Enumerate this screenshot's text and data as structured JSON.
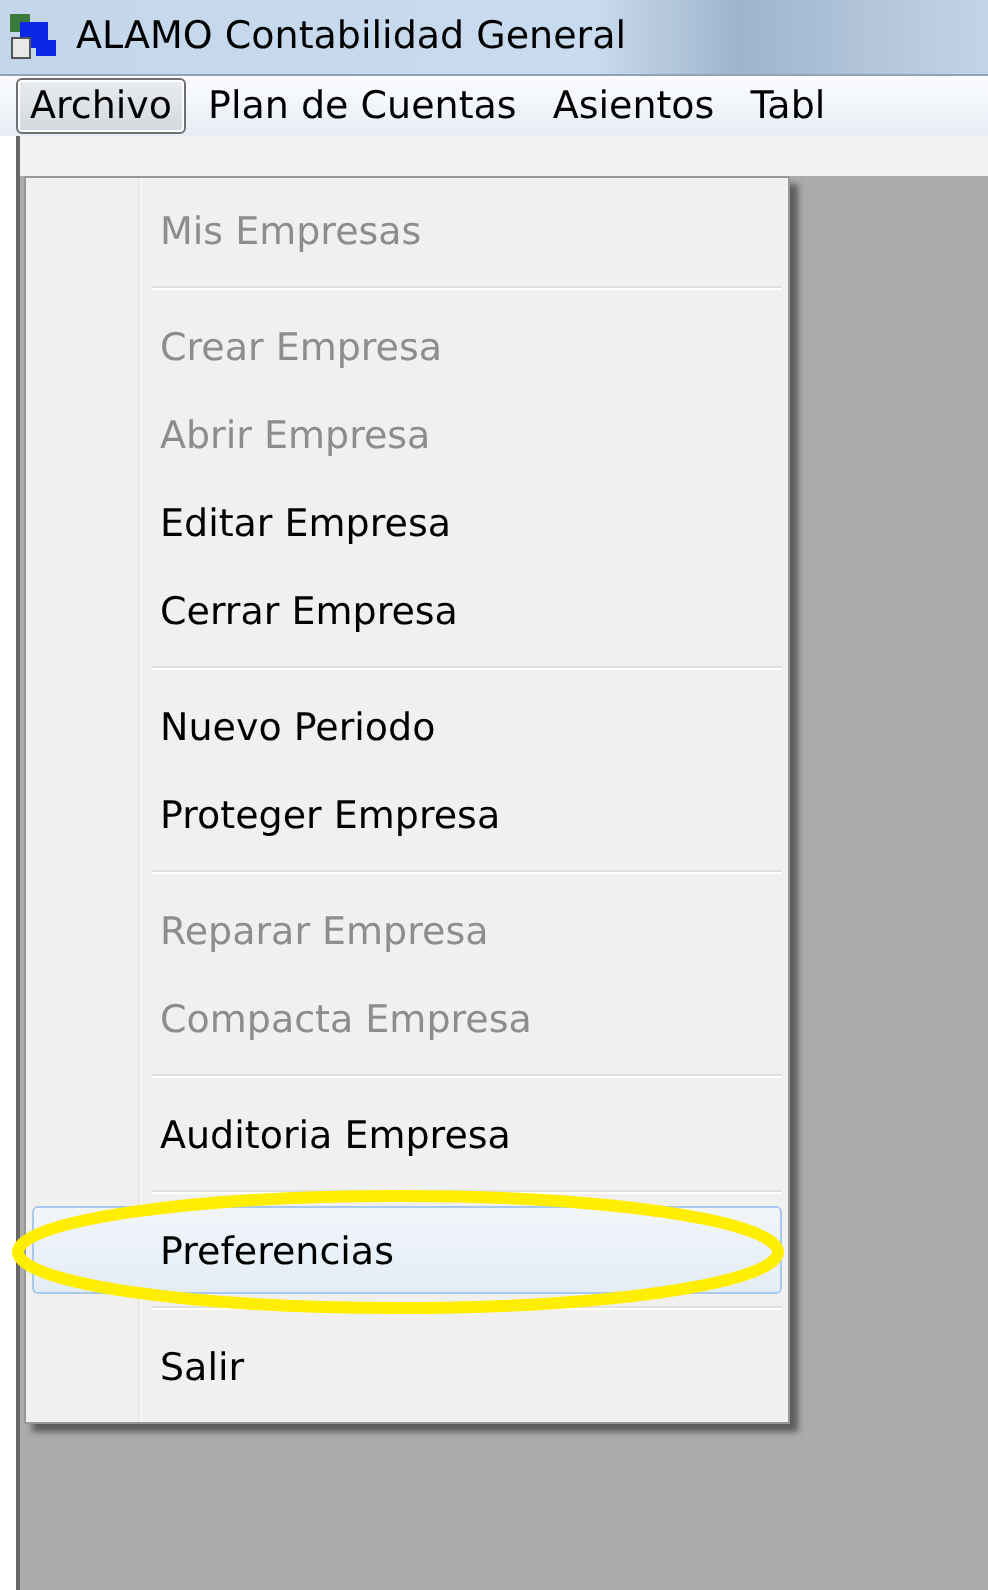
{
  "window": {
    "title": "ALAMO Contabilidad General"
  },
  "menubar": [
    {
      "label": "Archivo",
      "selected": true
    },
    {
      "label": "Plan de Cuentas",
      "selected": false
    },
    {
      "label": "Asientos",
      "selected": false
    },
    {
      "label": "Tabl",
      "selected": false
    }
  ],
  "menu": [
    {
      "kind": "item",
      "label": "Mis Empresas",
      "disabled": true,
      "selected": false,
      "circled": false
    },
    {
      "kind": "separator"
    },
    {
      "kind": "item",
      "label": "Crear Empresa",
      "disabled": true,
      "selected": false,
      "circled": false
    },
    {
      "kind": "item",
      "label": "Abrir Empresa",
      "disabled": true,
      "selected": false,
      "circled": false
    },
    {
      "kind": "item",
      "label": "Editar Empresa",
      "disabled": false,
      "selected": false,
      "circled": false
    },
    {
      "kind": "item",
      "label": "Cerrar Empresa",
      "disabled": false,
      "selected": false,
      "circled": false
    },
    {
      "kind": "separator"
    },
    {
      "kind": "item",
      "label": "Nuevo Periodo",
      "disabled": false,
      "selected": false,
      "circled": false
    },
    {
      "kind": "item",
      "label": "Proteger Empresa",
      "disabled": false,
      "selected": false,
      "circled": false
    },
    {
      "kind": "separator"
    },
    {
      "kind": "item",
      "label": "Reparar Empresa",
      "disabled": true,
      "selected": false,
      "circled": false
    },
    {
      "kind": "item",
      "label": "Compacta Empresa",
      "disabled": true,
      "selected": false,
      "circled": false
    },
    {
      "kind": "separator"
    },
    {
      "kind": "item",
      "label": "Auditoria Empresa",
      "disabled": false,
      "selected": false,
      "circled": false
    },
    {
      "kind": "separator"
    },
    {
      "kind": "item",
      "label": "Preferencias",
      "disabled": false,
      "selected": true,
      "circled": true
    },
    {
      "kind": "separator"
    },
    {
      "kind": "item",
      "label": "Salir",
      "disabled": false,
      "selected": false,
      "circled": false
    }
  ]
}
